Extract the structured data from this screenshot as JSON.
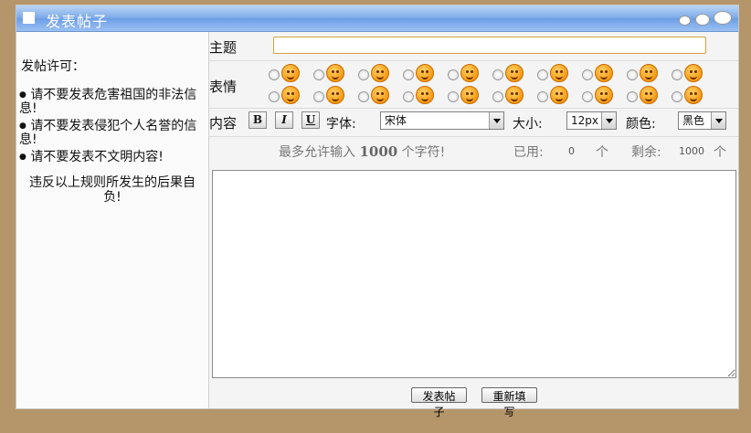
{
  "title": "发表帖子",
  "sidebar": {
    "heading": "发帖许可：",
    "rules": [
      "请不要发表危害祖国的非法信息!",
      "请不要发表侵犯个人名誉的信息!",
      "请不要发表不文明内容!"
    ],
    "warning": "违反以上规则所发生的后果自负!"
  },
  "form": {
    "subject_label": "主题",
    "subject_value": "",
    "emotion_label": "表情",
    "emoticon_count": 20,
    "content_label": "内容",
    "bold_label": "B",
    "italic_label": "I",
    "underline_label": "U",
    "font_label": "字体:",
    "font_value": "宋体",
    "size_label": "大小:",
    "size_value": "12px",
    "color_label": "颜色:",
    "color_value": "黑色",
    "max_text_prefix": "最多允许输入",
    "max_chars": "1000",
    "max_text_suffix": "个字符!",
    "used_label": "已用:",
    "used_value": "0",
    "used_unit": "个",
    "remaining_label": "剩余:",
    "remaining_value": "1000",
    "remaining_unit": "个",
    "content_value": "",
    "submit_label": "发表帖子",
    "reset_label": "重新填写"
  },
  "colors": {
    "background": "#b4966a",
    "title_bar": "#7aa8e8",
    "subject_border": "#d5a23a",
    "emoticon": "#f59a10"
  }
}
